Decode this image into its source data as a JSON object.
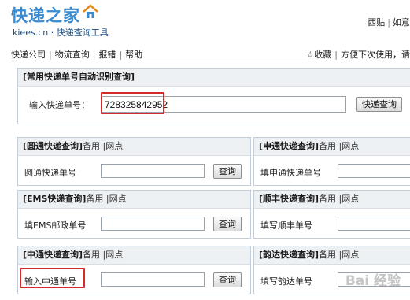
{
  "logo": {
    "text": "快递之家",
    "tagline": "kiees.cn · 快递查询工具"
  },
  "top_links": [
    "西贴",
    "如意"
  ],
  "nav": {
    "left": [
      "快递公司",
      "物流查询",
      "报错",
      "帮助"
    ],
    "right": [
      "☆收藏",
      "方便下次使用，请"
    ]
  },
  "auto_query": {
    "title": "[常用快递单号自动识别查询]",
    "label": "输入快递单号：",
    "value": "728325842952",
    "button": "快递查询"
  },
  "panels": [
    {
      "title": "[圆通快递查询]",
      "extras": "备用 |网点",
      "label": "圆通快递单号",
      "value": "",
      "button": "查询"
    },
    {
      "title": "[申通快递查询]",
      "extras": "备用 |网点",
      "label": "填申通快递单号",
      "value": "",
      "button": ""
    },
    {
      "title": "[EMS快递查询]",
      "extras": "备用 |网点",
      "label": "填EMS邮政单号",
      "value": "",
      "button": "查询"
    },
    {
      "title": "[顺丰快递查询]",
      "extras": "备用 |网点",
      "label": "填写顺丰单号",
      "value": "",
      "button": ""
    },
    {
      "title": "[中通快递查询]",
      "extras": "备用 |网点",
      "label": "输入中通单号",
      "value": "",
      "button": "查询"
    },
    {
      "title": "[韵达快递查询]",
      "extras": "备用 |网点",
      "label": "填写韵达单号",
      "value": "",
      "button": ""
    }
  ],
  "watermark": "Bai 经验",
  "colors": {
    "logo": "#3a8bd0",
    "panel_header": "#eef1f4",
    "panel_border": "#c3cdd8",
    "highlight": "#d42a2a"
  }
}
